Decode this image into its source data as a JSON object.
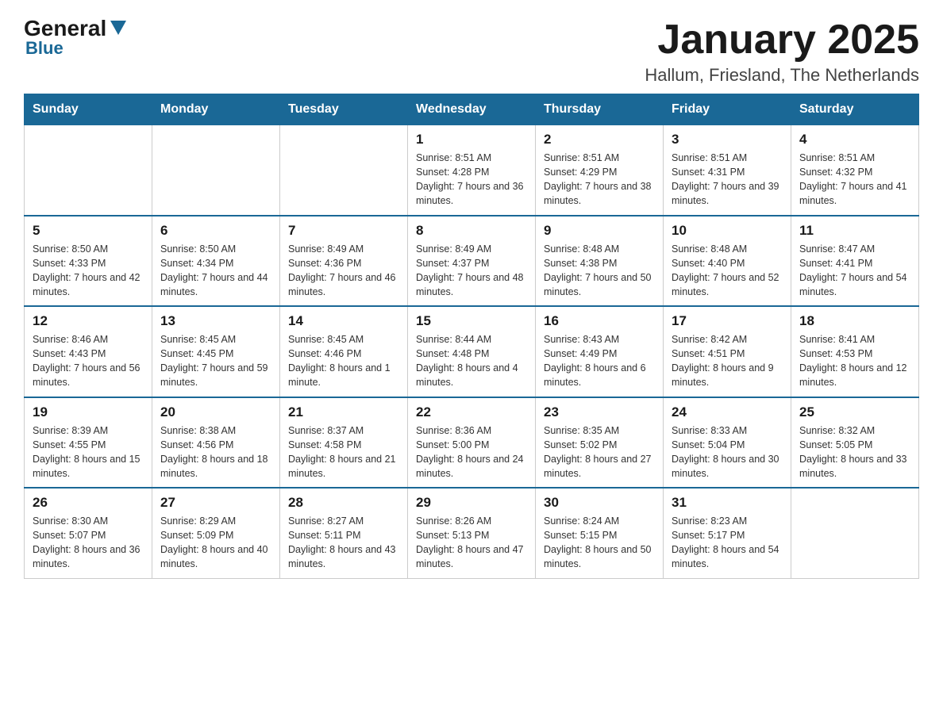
{
  "header": {
    "logo_general": "General",
    "logo_blue": "Blue",
    "title": "January 2025",
    "location": "Hallum, Friesland, The Netherlands"
  },
  "calendar": {
    "days_of_week": [
      "Sunday",
      "Monday",
      "Tuesday",
      "Wednesday",
      "Thursday",
      "Friday",
      "Saturday"
    ],
    "weeks": [
      [
        {
          "day": "",
          "info": ""
        },
        {
          "day": "",
          "info": ""
        },
        {
          "day": "",
          "info": ""
        },
        {
          "day": "1",
          "info": "Sunrise: 8:51 AM\nSunset: 4:28 PM\nDaylight: 7 hours and 36 minutes."
        },
        {
          "day": "2",
          "info": "Sunrise: 8:51 AM\nSunset: 4:29 PM\nDaylight: 7 hours and 38 minutes."
        },
        {
          "day": "3",
          "info": "Sunrise: 8:51 AM\nSunset: 4:31 PM\nDaylight: 7 hours and 39 minutes."
        },
        {
          "day": "4",
          "info": "Sunrise: 8:51 AM\nSunset: 4:32 PM\nDaylight: 7 hours and 41 minutes."
        }
      ],
      [
        {
          "day": "5",
          "info": "Sunrise: 8:50 AM\nSunset: 4:33 PM\nDaylight: 7 hours and 42 minutes."
        },
        {
          "day": "6",
          "info": "Sunrise: 8:50 AM\nSunset: 4:34 PM\nDaylight: 7 hours and 44 minutes."
        },
        {
          "day": "7",
          "info": "Sunrise: 8:49 AM\nSunset: 4:36 PM\nDaylight: 7 hours and 46 minutes."
        },
        {
          "day": "8",
          "info": "Sunrise: 8:49 AM\nSunset: 4:37 PM\nDaylight: 7 hours and 48 minutes."
        },
        {
          "day": "9",
          "info": "Sunrise: 8:48 AM\nSunset: 4:38 PM\nDaylight: 7 hours and 50 minutes."
        },
        {
          "day": "10",
          "info": "Sunrise: 8:48 AM\nSunset: 4:40 PM\nDaylight: 7 hours and 52 minutes."
        },
        {
          "day": "11",
          "info": "Sunrise: 8:47 AM\nSunset: 4:41 PM\nDaylight: 7 hours and 54 minutes."
        }
      ],
      [
        {
          "day": "12",
          "info": "Sunrise: 8:46 AM\nSunset: 4:43 PM\nDaylight: 7 hours and 56 minutes."
        },
        {
          "day": "13",
          "info": "Sunrise: 8:45 AM\nSunset: 4:45 PM\nDaylight: 7 hours and 59 minutes."
        },
        {
          "day": "14",
          "info": "Sunrise: 8:45 AM\nSunset: 4:46 PM\nDaylight: 8 hours and 1 minute."
        },
        {
          "day": "15",
          "info": "Sunrise: 8:44 AM\nSunset: 4:48 PM\nDaylight: 8 hours and 4 minutes."
        },
        {
          "day": "16",
          "info": "Sunrise: 8:43 AM\nSunset: 4:49 PM\nDaylight: 8 hours and 6 minutes."
        },
        {
          "day": "17",
          "info": "Sunrise: 8:42 AM\nSunset: 4:51 PM\nDaylight: 8 hours and 9 minutes."
        },
        {
          "day": "18",
          "info": "Sunrise: 8:41 AM\nSunset: 4:53 PM\nDaylight: 8 hours and 12 minutes."
        }
      ],
      [
        {
          "day": "19",
          "info": "Sunrise: 8:39 AM\nSunset: 4:55 PM\nDaylight: 8 hours and 15 minutes."
        },
        {
          "day": "20",
          "info": "Sunrise: 8:38 AM\nSunset: 4:56 PM\nDaylight: 8 hours and 18 minutes."
        },
        {
          "day": "21",
          "info": "Sunrise: 8:37 AM\nSunset: 4:58 PM\nDaylight: 8 hours and 21 minutes."
        },
        {
          "day": "22",
          "info": "Sunrise: 8:36 AM\nSunset: 5:00 PM\nDaylight: 8 hours and 24 minutes."
        },
        {
          "day": "23",
          "info": "Sunrise: 8:35 AM\nSunset: 5:02 PM\nDaylight: 8 hours and 27 minutes."
        },
        {
          "day": "24",
          "info": "Sunrise: 8:33 AM\nSunset: 5:04 PM\nDaylight: 8 hours and 30 minutes."
        },
        {
          "day": "25",
          "info": "Sunrise: 8:32 AM\nSunset: 5:05 PM\nDaylight: 8 hours and 33 minutes."
        }
      ],
      [
        {
          "day": "26",
          "info": "Sunrise: 8:30 AM\nSunset: 5:07 PM\nDaylight: 8 hours and 36 minutes."
        },
        {
          "day": "27",
          "info": "Sunrise: 8:29 AM\nSunset: 5:09 PM\nDaylight: 8 hours and 40 minutes."
        },
        {
          "day": "28",
          "info": "Sunrise: 8:27 AM\nSunset: 5:11 PM\nDaylight: 8 hours and 43 minutes."
        },
        {
          "day": "29",
          "info": "Sunrise: 8:26 AM\nSunset: 5:13 PM\nDaylight: 8 hours and 47 minutes."
        },
        {
          "day": "30",
          "info": "Sunrise: 8:24 AM\nSunset: 5:15 PM\nDaylight: 8 hours and 50 minutes."
        },
        {
          "day": "31",
          "info": "Sunrise: 8:23 AM\nSunset: 5:17 PM\nDaylight: 8 hours and 54 minutes."
        },
        {
          "day": "",
          "info": ""
        }
      ]
    ]
  }
}
